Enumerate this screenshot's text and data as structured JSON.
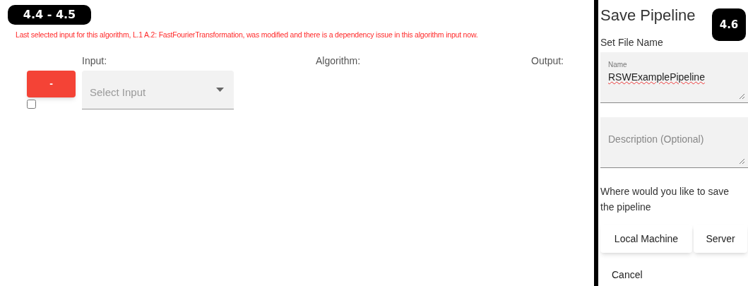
{
  "badges": [
    {
      "label": "4.4 - 4.5"
    },
    {
      "label": "4.6"
    }
  ],
  "error_message": "Last selected input for this algorithm, L.1 A.2: FastFourierTransformation, was modified and there is a dependency issue in this algorithm input now.",
  "columns": [
    "Input:",
    "Algorithm:",
    "Output:"
  ],
  "row": {
    "remove_button": "-",
    "checked": false,
    "input_select": {
      "placeholder": "Select Input"
    }
  },
  "save_panel": {
    "title": "Save Pipeline",
    "section_label": "Set File Name",
    "name_field": {
      "label": "Name",
      "value": "RSWExamplePipeline"
    },
    "description_field": {
      "placeholder": "Description (Optional)"
    },
    "prompt": "Where would you like to save the pipeline",
    "buttons": [
      "Local Machine",
      "Server"
    ],
    "cancel": "Cancel"
  }
}
